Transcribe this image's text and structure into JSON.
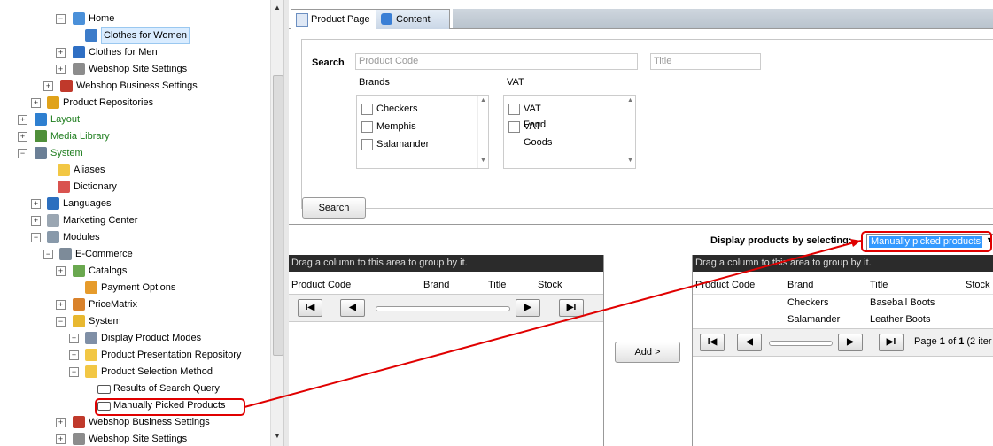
{
  "tree": {
    "items": [
      {
        "label": "Home",
        "icon": "home-icon",
        "expander": "−"
      },
      {
        "label": "Clothes for Women",
        "icon": "grid-page-icon",
        "expander": ""
      },
      {
        "label": "Clothes for Men",
        "icon": "shirt-icon",
        "expander": "+"
      },
      {
        "label": "Webshop Site Settings",
        "icon": "gear-icon",
        "expander": "+"
      },
      {
        "label": "Webshop Business Settings",
        "icon": "business-icon",
        "expander": "+"
      },
      {
        "label": "Product Repositories",
        "icon": "box-icon",
        "expander": "+"
      },
      {
        "label": "Layout",
        "icon": "layout-icon",
        "expander": "+"
      },
      {
        "label": "Media Library",
        "icon": "media-icon",
        "expander": "+"
      },
      {
        "label": "System",
        "icon": "system-icon",
        "expander": "−"
      },
      {
        "label": "Aliases",
        "icon": "folder-icon",
        "expander": ""
      },
      {
        "label": "Dictionary",
        "icon": "book-icon",
        "expander": ""
      },
      {
        "label": "Languages",
        "icon": "flag-icon",
        "expander": "+"
      },
      {
        "label": "Marketing Center",
        "icon": "marketing-icon",
        "expander": "+"
      },
      {
        "label": "Modules",
        "icon": "module-icon",
        "expander": "−"
      },
      {
        "label": "E-Commerce",
        "icon": "ecommerce-icon",
        "expander": "−"
      },
      {
        "label": "Catalogs",
        "icon": "catalog-icon",
        "expander": "+"
      },
      {
        "label": "Payment Options",
        "icon": "payment-icon",
        "expander": ""
      },
      {
        "label": "PriceMatrix",
        "icon": "pricematrix-icon",
        "expander": "+"
      },
      {
        "label": "System",
        "icon": "folder-gear-icon",
        "expander": "−"
      },
      {
        "label": "Display Product Modes",
        "icon": "display-modes-icon",
        "expander": "+"
      },
      {
        "label": "Product Presentation Repository",
        "icon": "folder-icon",
        "expander": "+"
      },
      {
        "label": "Product Selection Method",
        "icon": "folder-icon",
        "expander": "−"
      },
      {
        "label": "Results of Search Query",
        "icon": "field-icon",
        "expander": ""
      },
      {
        "label": "Manually Picked Products",
        "icon": "field-icon",
        "expander": ""
      },
      {
        "label": "Webshop Business Settings",
        "icon": "business-icon",
        "expander": "+"
      },
      {
        "label": "Webshop Site Settings",
        "icon": "gear-icon",
        "expander": "+"
      }
    ]
  },
  "tabs": [
    {
      "label": "Product Page",
      "icon": "page-icon"
    },
    {
      "label": "Content",
      "icon": "cube-icon"
    }
  ],
  "search": {
    "label": "Search",
    "product_code_placeholder": "Product Code",
    "title_placeholder": "Title",
    "brands_label": "Brands",
    "brands": [
      "Checkers",
      "Memphis",
      "Salamander"
    ],
    "vat_label": "VAT",
    "vat": [
      "VAT Food",
      "VAT Goods"
    ],
    "button": "Search"
  },
  "display": {
    "label": "Display products by selecting:",
    "selected": "Manually picked products"
  },
  "left_grid": {
    "group_hint": "Drag a column to this area to group by it.",
    "columns": [
      "Product Code",
      "Brand",
      "Title",
      "Stock"
    ]
  },
  "add_button": "Add >",
  "right_grid": {
    "group_hint": "Drag a column to this area to group by it.",
    "columns": [
      "Product Code",
      "Brand",
      "Title",
      "Stock"
    ],
    "rows": [
      {
        "code": "",
        "brand": "Checkers",
        "title": "Baseball Boots",
        "stock": ""
      },
      {
        "code": "",
        "brand": "Salamander",
        "title": "Leather Boots",
        "stock": ""
      }
    ],
    "pager_prefix": "Page",
    "pager_current": "1",
    "pager_of": "of",
    "pager_total": "1",
    "pager_items": "(2 iter"
  },
  "pager_glyphs": {
    "first": "I◀",
    "prev": "◀",
    "next": "▶",
    "last": "▶I"
  },
  "accent_red": "#e00000"
}
